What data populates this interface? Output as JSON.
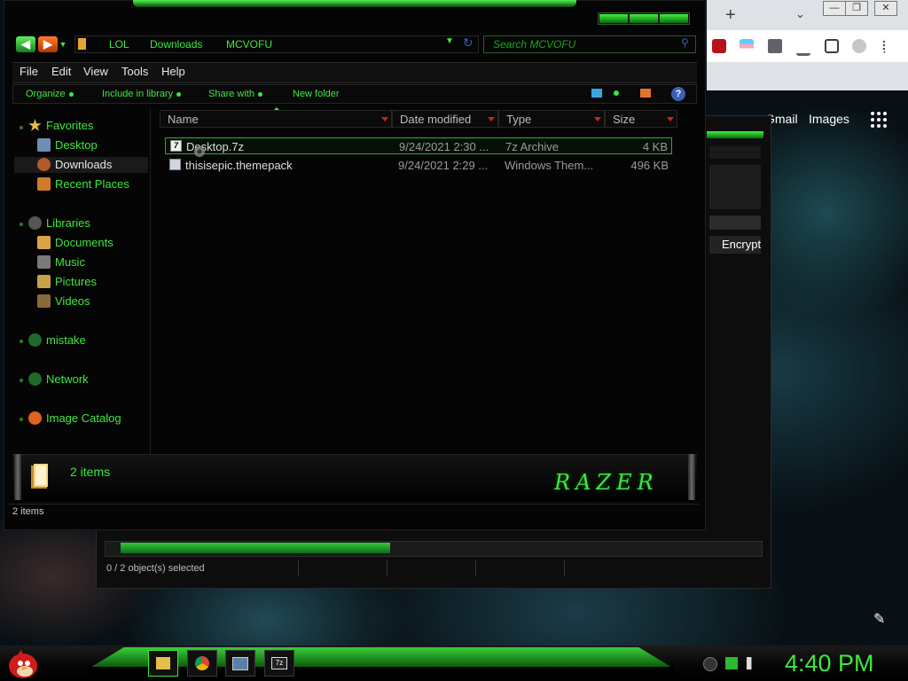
{
  "explorer": {
    "breadcrumb": [
      "LOL",
      "Downloads",
      "MCVOFU"
    ],
    "search_placeholder": "Search MCVOFU",
    "menu": [
      "File",
      "Edit",
      "View",
      "Tools",
      "Help"
    ],
    "commands": [
      "Organize",
      "Include in library",
      "Share with",
      "New folder"
    ],
    "sidebar": {
      "favorites": {
        "label": "Favorites",
        "items": [
          "Desktop",
          "Downloads",
          "Recent Places"
        ]
      },
      "libraries": {
        "label": "Libraries",
        "items": [
          "Documents",
          "Music",
          "Pictures",
          "Videos"
        ]
      },
      "mistake": "mistake",
      "network": "Network",
      "image_catalog": "Image Catalog"
    },
    "columns": [
      "Name",
      "Date modified",
      "Type",
      "Size"
    ],
    "files": [
      {
        "name": "Desktop.7z",
        "date": "9/24/2021 2:30 ...",
        "type": "7z Archive",
        "size": "4 KB",
        "selected": true
      },
      {
        "name": "thisisepic.themepack",
        "date": "9/24/2021 2:29 ...",
        "type": "Windows Them...",
        "size": "496 KB",
        "selected": false
      }
    ],
    "details_count": "2 items",
    "brand": "RAZER",
    "status": "2 items"
  },
  "background_window": {
    "encrypt_label": "Encrypt",
    "status": "0 / 2 object(s) selected",
    "progress": 0.43
  },
  "chrome": {
    "links": [
      "Gmail",
      "Images"
    ]
  },
  "taskbar": {
    "clock": "4:40 PM"
  },
  "colors": {
    "accent": "#3ee83e",
    "selection_border": "#2cae2c"
  }
}
